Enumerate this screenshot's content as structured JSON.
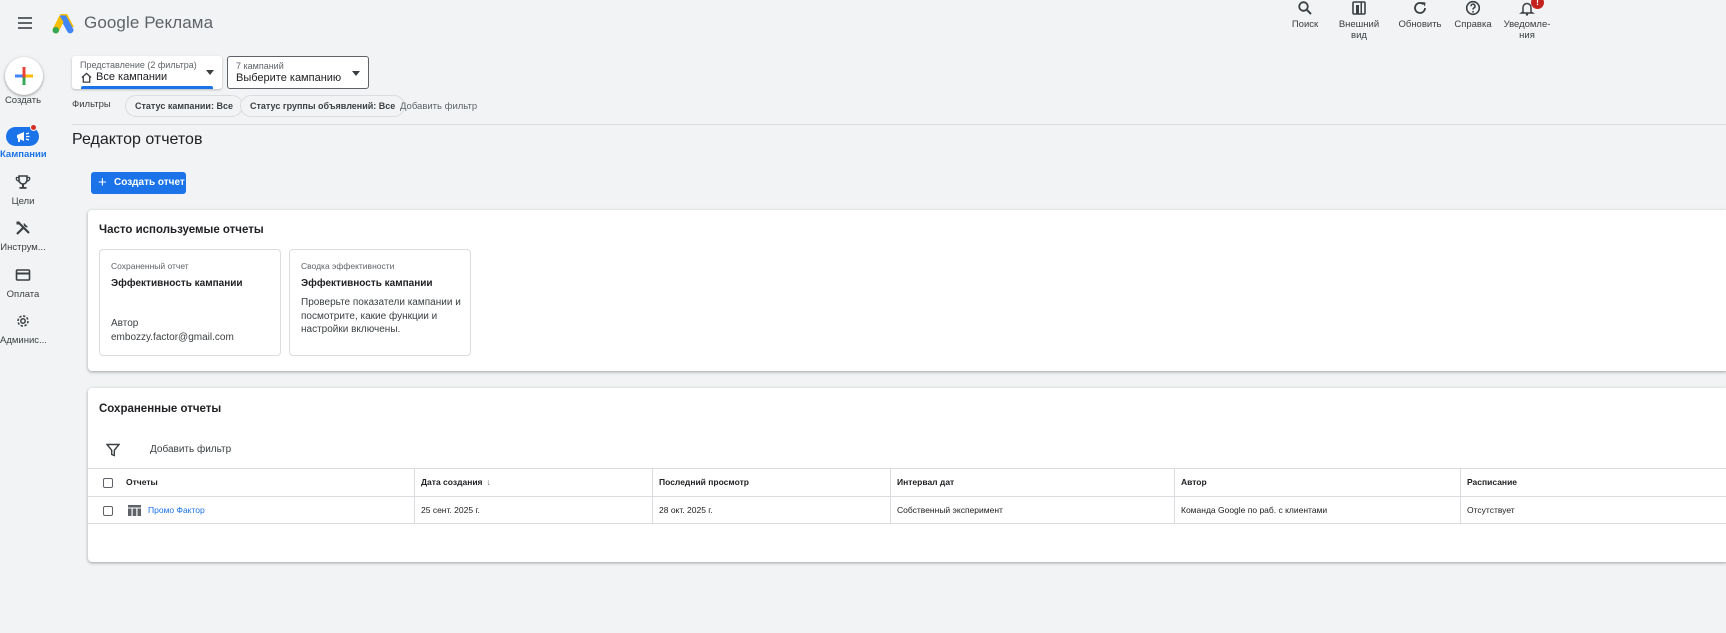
{
  "header": {
    "app_title": "Google Реклама",
    "actions": [
      {
        "label": "Поиск",
        "icon": "search-icon"
      },
      {
        "label": "Внешний вид",
        "icon": "appearance-icon"
      },
      {
        "label": "Обновить",
        "icon": "refresh-icon"
      },
      {
        "label": "Справка",
        "icon": "help-icon"
      },
      {
        "label": "Уведомле-ния",
        "icon": "bell-icon",
        "badge": "!"
      }
    ]
  },
  "nav": {
    "create_label": "Создать",
    "items": [
      {
        "label": "Кампании",
        "icon": "campaigns-icon",
        "active": true
      },
      {
        "label": "Цели",
        "icon": "trophy-icon"
      },
      {
        "label": "Инструм...",
        "icon": "tools-icon"
      },
      {
        "label": "Оплата",
        "icon": "billing-icon"
      },
      {
        "label": "Админис...",
        "icon": "admin-gear-icon"
      }
    ]
  },
  "view_selector": {
    "small": "Представление (2 фильтра)",
    "value": "Все кампании"
  },
  "campaign_selector": {
    "small": "7 кампаний",
    "value": "Выберите кампанию"
  },
  "filters": {
    "label": "Фильтры",
    "chips": [
      "Статус кампании: Все",
      "Статус группы объявлений: Все"
    ],
    "add_filter": "Добавить фильтр"
  },
  "page": {
    "title": "Редактор отчетов",
    "create_button": "Создать отчет"
  },
  "frequent": {
    "heading": "Часто используемые отчеты",
    "cards": [
      {
        "kind": "Сохраненный отчет",
        "name": "Эффективность кампании",
        "author_label": "Автор",
        "author": "embozzy.factor@gmail.com"
      },
      {
        "kind": "Сводка эффективности",
        "name": "Эффективность кампании",
        "description": "Проверьте показатели кампании и посмотрите, какие функции и настройки включены."
      }
    ]
  },
  "saved": {
    "heading": "Сохраненные отчеты",
    "add_filter": "Добавить фильтр",
    "columns": [
      "Отчеты",
      "Дата создания",
      "Последний просмотр",
      "Интервал дат",
      "Автор",
      "Расписание"
    ],
    "sort_indicator": "↓",
    "rows": [
      {
        "name": "Промо Фактор",
        "created": "25 сент. 2025 г.",
        "last_viewed": "28 окт. 2025 г.",
        "date_range": "Собственный эксперимент",
        "author": "Команда Google по раб. с клиентами",
        "schedule": "Отсутствует"
      }
    ]
  },
  "colors": {
    "accent": "#1a73e8",
    "background": "#f1f3f4",
    "badge": "#c5221f"
  }
}
